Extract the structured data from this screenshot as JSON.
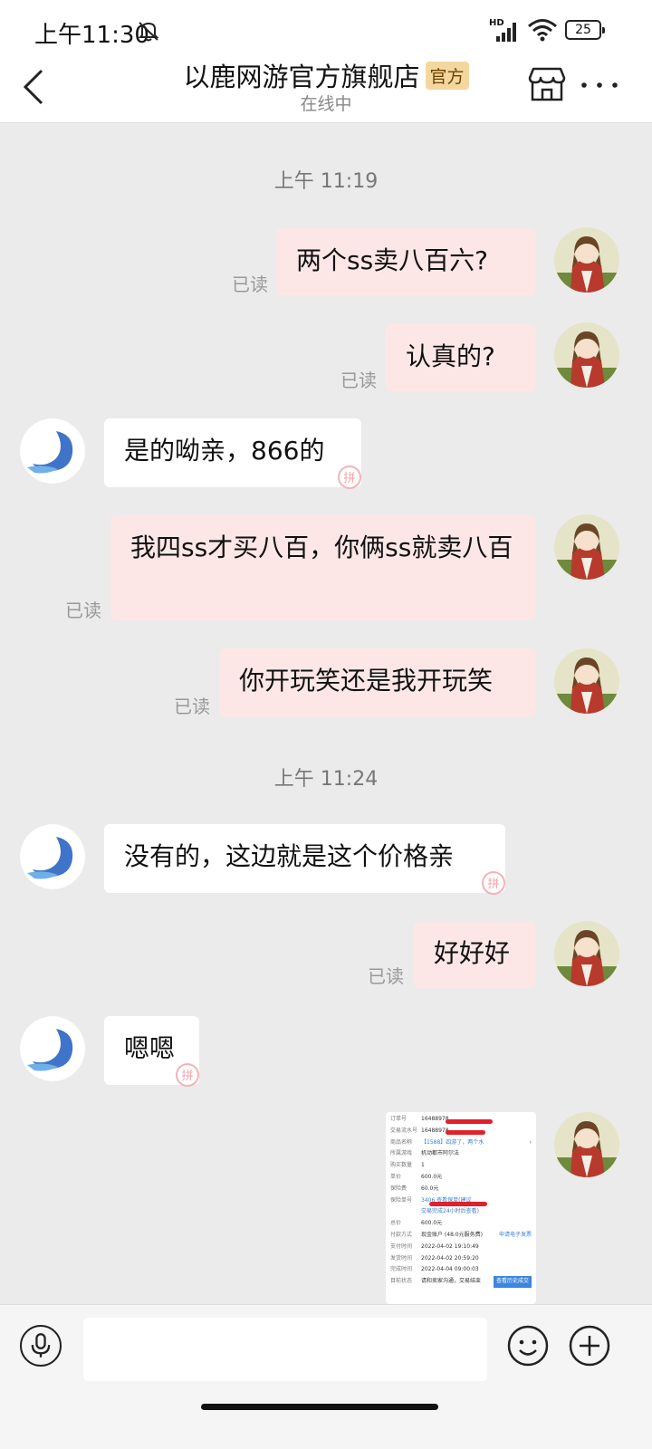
{
  "status_bar": {
    "time": "上午11:30",
    "network": "HD",
    "battery": "25"
  },
  "header": {
    "shop_name": "以鹿网游官方旗舰店",
    "badge": "官方",
    "online_status": "在线中"
  },
  "chat": {
    "timestamps": [
      "上午 11:19",
      "上午 11:24"
    ],
    "read_label": "已读",
    "messages": [
      {
        "from": "me",
        "text": "两个ss卖八百六?",
        "read": true
      },
      {
        "from": "me",
        "text": "认真的?",
        "read": true
      },
      {
        "from": "shop",
        "text": "是的呦亲，866的"
      },
      {
        "from": "me",
        "text": "我四ss才买八百，你俩ss就卖八百",
        "read": true
      },
      {
        "from": "me",
        "text": "你开玩笑还是我开玩笑",
        "read": true
      },
      {
        "from": "shop",
        "text": "没有的，这边就是这个价格亲"
      },
      {
        "from": "me",
        "text": "好好好",
        "read": true
      },
      {
        "from": "shop",
        "text": "嗯嗯"
      },
      {
        "from": "me",
        "type": "image"
      }
    ],
    "image_message": {
      "rows": [
        {
          "key": "订单号",
          "value": "16488978"
        },
        {
          "key": "交易流水号",
          "value": "16488978"
        },
        {
          "key": "商品名称",
          "value": "【1588】四游了，两个水"
        },
        {
          "key": "所属游戏",
          "value": "机动都市阿尔法"
        },
        {
          "key": "购买数量",
          "value": "1"
        },
        {
          "key": "单价",
          "value": "600.0元"
        },
        {
          "key": "保险费",
          "value": "60.0元"
        },
        {
          "key": "保险单号",
          "value": "3406 查看保单(建议"
        },
        {
          "key": "",
          "value": "交易完成24小时后查看)"
        },
        {
          "key": "总价",
          "value": "600.0元"
        },
        {
          "key": "付款方式",
          "value": "现金账户 (48.0元服务费)"
        },
        {
          "key": "支付时间",
          "value": "2022-04-02 19:10:49"
        },
        {
          "key": "发货时间",
          "value": "2022-04-02 20:59:20"
        },
        {
          "key": "完成时间",
          "value": "2022-04-04 09:00:03"
        },
        {
          "key": "目前状态",
          "value": "请和卖家沟通，交易结束"
        }
      ],
      "side_links": {
        "invoice": "申请电子发票",
        "view": "查看历史成交",
        "chevron": "›"
      }
    }
  },
  "input_bar": {
    "placeholder": ""
  },
  "colors": {
    "my_bubble": "#fde7e6",
    "their_bubble": "#ffffff",
    "badge": "#f4d79f",
    "background": "#ebebeb"
  }
}
